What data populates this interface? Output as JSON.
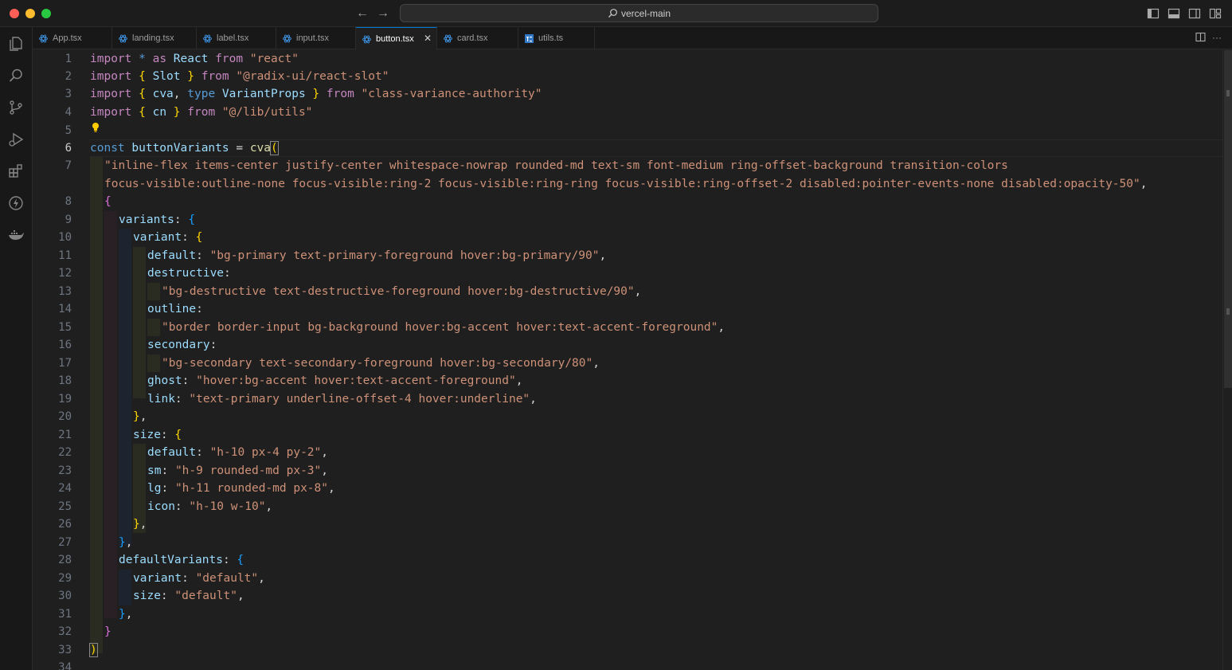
{
  "titlebar": {
    "search_text": "vercel-main",
    "back_icon": "arrow-left-icon",
    "forward_icon": "arrow-right-icon"
  },
  "activity_bar": {
    "items": [
      "explorer-icon",
      "search-icon",
      "source-control-icon",
      "run-debug-icon",
      "extensions-icon",
      "lightning-icon",
      "docker-icon"
    ]
  },
  "tabs": [
    {
      "label": "App.tsx",
      "active": false
    },
    {
      "label": "landing.tsx",
      "active": false
    },
    {
      "label": "label.tsx",
      "active": false
    },
    {
      "label": "input.tsx",
      "active": false
    },
    {
      "label": "button.tsx",
      "active": true
    },
    {
      "label": "card.tsx",
      "active": false
    },
    {
      "label": "utils.ts",
      "active": false
    }
  ],
  "tab_close_glyph": "✕",
  "tab_actions": {
    "split": "split-editor-icon",
    "more": "···"
  },
  "editor": {
    "active_line": "6",
    "line_numbers": [
      "1",
      "2",
      "3",
      "4",
      "5",
      "6",
      "7",
      "8",
      "9",
      "10",
      "11",
      "12",
      "13",
      "14",
      "15",
      "16",
      "17",
      "18",
      "19",
      "20",
      "21",
      "22",
      "23",
      "24",
      "25",
      "26",
      "27",
      "28",
      "29",
      "30",
      "31",
      "32",
      "33",
      "34"
    ],
    "lines": [
      "import * as React from \"react\"",
      "import { Slot } from \"@radix-ui/react-slot\"",
      "import { cva, type VariantProps } from \"class-variance-authority\"",
      "import { cn } from \"@/lib/utils\"",
      "",
      "const buttonVariants = cva(",
      "  \"inline-flex items-center justify-center whitespace-nowrap rounded-md text-sm font-medium ring-offset-background transition-colors",
      "  focus-visible:outline-none focus-visible:ring-2 focus-visible:ring-ring focus-visible:ring-offset-2 disabled:pointer-events-none disabled:opacity-50\",",
      "  {",
      "    variants: {",
      "      variant: {",
      "        default: \"bg-primary text-primary-foreground hover:bg-primary/90\",",
      "        destructive:",
      "          \"bg-destructive text-destructive-foreground hover:bg-destructive/90\",",
      "        outline:",
      "          \"border border-input bg-background hover:bg-accent hover:text-accent-foreground\",",
      "        secondary:",
      "          \"bg-secondary text-secondary-foreground hover:bg-secondary/80\",",
      "        ghost: \"hover:bg-accent hover:text-accent-foreground\",",
      "        link: \"text-primary underline-offset-4 hover:underline\",",
      "      },",
      "      size: {",
      "        default: \"h-10 px-4 py-2\",",
      "        sm: \"h-9 rounded-md px-3\",",
      "        lg: \"h-11 rounded-md px-8\",",
      "        icon: \"h-10 w-10\",",
      "      },",
      "    },",
      "    defaultVariants: {",
      "      variant: \"default\",",
      "      size: \"default\",",
      "    },",
      "  }",
      ")"
    ]
  },
  "colors": {
    "keyword": "#569cd6",
    "import_keyword": "#c586c0",
    "string": "#ce9178",
    "variable": "#9cdcfe",
    "function": "#dcdcaa",
    "type": "#4ec9b0",
    "accent": "#0078d4"
  }
}
